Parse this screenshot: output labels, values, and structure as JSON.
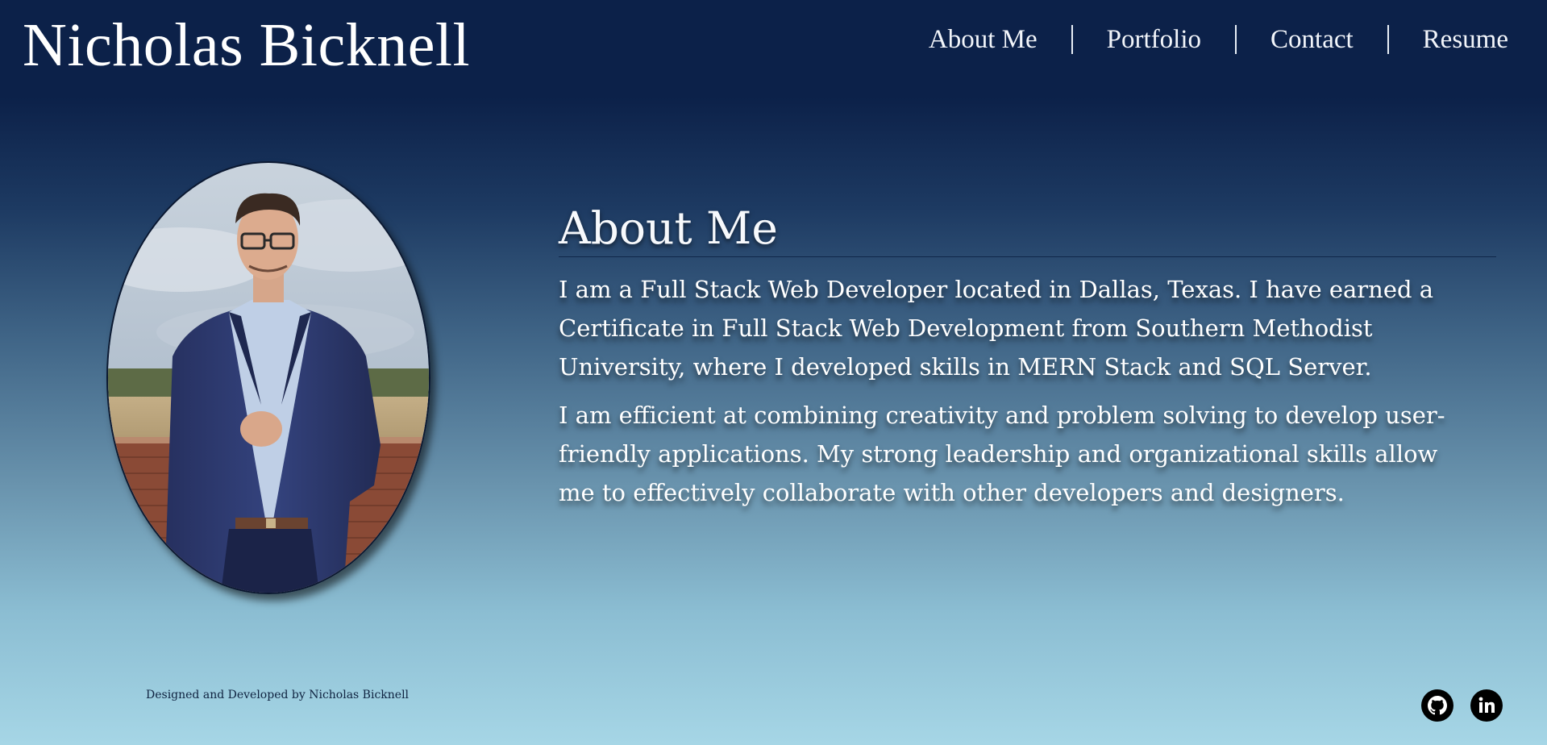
{
  "header": {
    "site_title": "Nicholas Bicknell",
    "nav": [
      {
        "label": "About Me"
      },
      {
        "label": "Portfolio"
      },
      {
        "label": "Contact"
      },
      {
        "label": "Resume"
      }
    ]
  },
  "about": {
    "heading": "About Me",
    "paragraphs": [
      "I am a Full Stack Web Developer located in Dallas, Texas. I have earned a Certificate in Full Stack Web Development from Southern Methodist University, where I developed skills in MERN Stack and SQL Server.",
      "I am efficient at combining creativity and problem solving to develop user-friendly applications. My strong leadership and organizational skills allow me to effectively collaborate with other developers and designers."
    ]
  },
  "footer": {
    "credit": "Designed and Developed by Nicholas Bicknell",
    "social": [
      {
        "icon": "github-icon"
      },
      {
        "icon": "linkedin-icon"
      }
    ]
  },
  "colors": {
    "header_bg": "#0c2149",
    "gradient_bottom": "#a6d6e6",
    "text": "#ffffff",
    "footer_text": "#0f2340"
  }
}
